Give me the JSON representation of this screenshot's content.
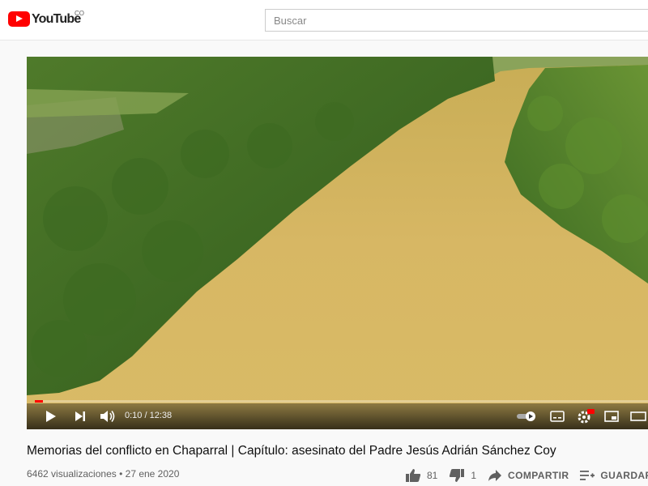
{
  "header": {
    "logo_text": "YouTube",
    "region": "CO",
    "search_placeholder": "Buscar"
  },
  "player": {
    "time": "0:10 / 12:38",
    "progress": 0.013,
    "progress_color": "#ff0000"
  },
  "video": {
    "title": "Memorias del conflicto en Chaparral | Capítulo: asesinato del Padre Jesús Adrián Sánchez Coy",
    "views": "6462 visualizaciones",
    "date": "27 ene 2020"
  },
  "actions": {
    "likes": "81",
    "dislikes": "1",
    "share_label": "COMPARTIR",
    "save_label": "GUARDAR"
  },
  "icons": [
    "play-icon",
    "next-icon",
    "volume-icon",
    "autoplay-toggle-icon",
    "subtitles-icon",
    "settings-icon",
    "miniplayer-icon",
    "theater-icon",
    "like-icon",
    "dislike-icon",
    "share-icon",
    "save-icon"
  ]
}
